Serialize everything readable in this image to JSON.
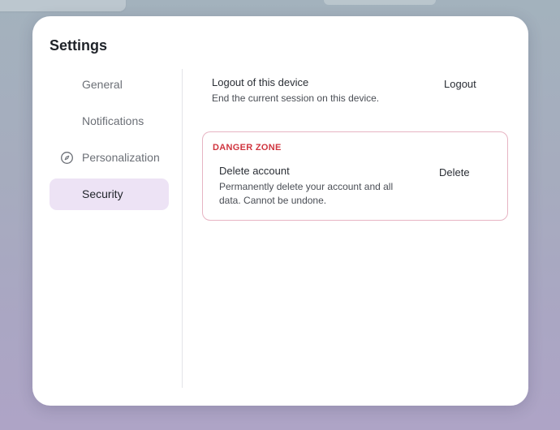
{
  "dialog": {
    "title": "Settings"
  },
  "nav": {
    "items": [
      {
        "label": "General",
        "icon": "",
        "active": false
      },
      {
        "label": "Notifications",
        "icon": "",
        "active": false
      },
      {
        "label": "Personalization",
        "icon": "compass-icon",
        "active": false
      },
      {
        "label": "Security",
        "icon": "",
        "active": true
      }
    ]
  },
  "security": {
    "logout": {
      "title": "Logout of this device",
      "description": "End the current session on this device.",
      "button_label": "Logout"
    },
    "danger_zone": {
      "heading": "DANGER ZONE",
      "delete": {
        "title": "Delete account",
        "description": "Permanently delete your account and all data. Cannot be undone.",
        "button_label": "Delete"
      }
    }
  },
  "colors": {
    "active_nav_bg": "#ede3f5",
    "danger_text": "#d0353f",
    "danger_border": "#e7b4c3"
  }
}
